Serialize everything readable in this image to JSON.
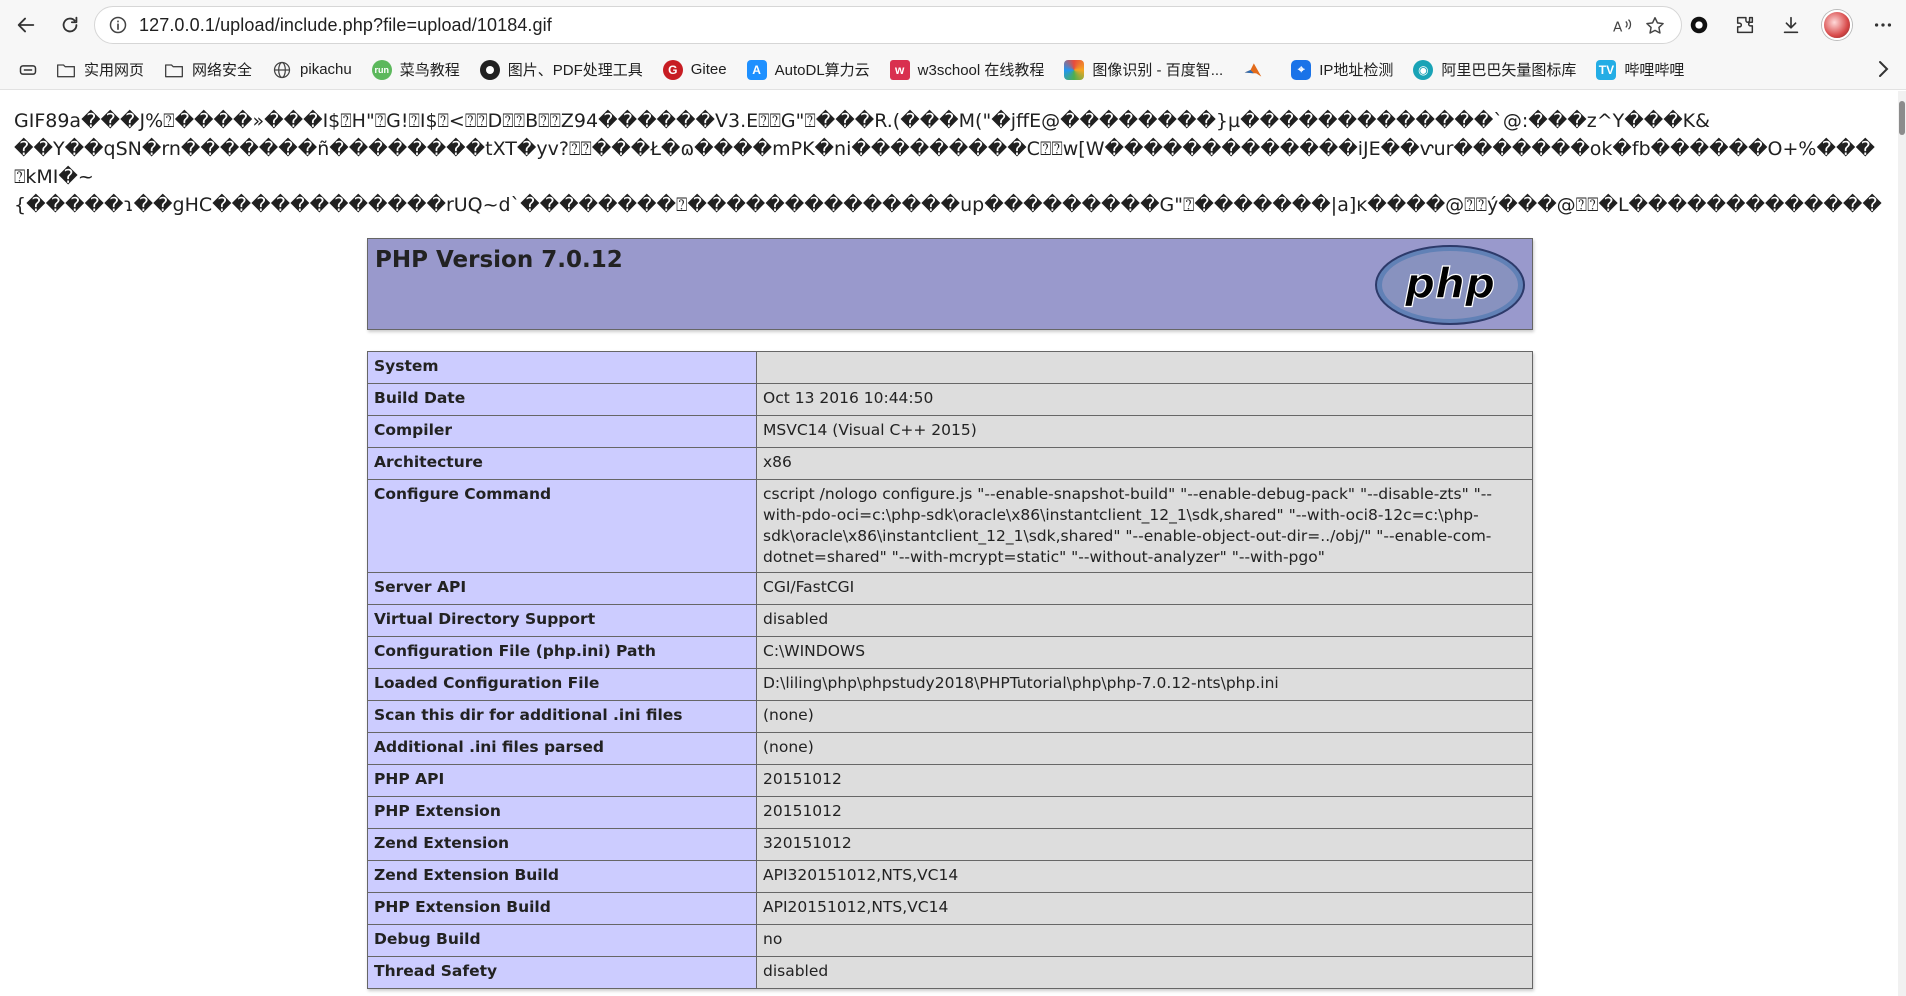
{
  "browser": {
    "url": "127.0.0.1/upload/include.php?file=upload/10184.gif",
    "bookmarks": [
      {
        "label": "实用网页",
        "icon": "folder-icon"
      },
      {
        "label": "网络安全",
        "icon": "folder-icon"
      },
      {
        "label": "pikachu",
        "icon": "globe-icon"
      },
      {
        "label": "菜鸟教程",
        "icon": "runoob-icon"
      },
      {
        "label": "图片、PDF处理工具",
        "icon": "tool-icon"
      },
      {
        "label": "Gitee",
        "icon": "gitee-icon"
      },
      {
        "label": "AutoDL算力云",
        "icon": "autodl-icon"
      },
      {
        "label": "w3school 在线教程",
        "icon": "w3school-icon"
      },
      {
        "label": "图像识别 - 百度智...",
        "icon": "baidu-ai-icon"
      },
      {
        "label": "",
        "icon": "matlab-icon"
      },
      {
        "label": "IP地址检测",
        "icon": "ip-icon"
      },
      {
        "label": "阿里巴巴矢量图标库",
        "icon": "iconfont-icon"
      },
      {
        "label": "哔哩哔哩",
        "icon": "bilibili-icon"
      }
    ]
  },
  "garbage_lines": [
    "GIF89a���J%⍰����»���I$⍰H\"⍰G!⍰I$⍰<⍰⍰D⍰⍰B⍰⍰Z94������V3.E⍰⍰G\"⍰���R.(���M(\"�jffE@��������}µ�������������`@:���z^Y���K&",
    "��Y��qSN�rn�������ñ��������tXT�yv?⍰⍰���Ł�ɷ����mPK�ni���������C⍰⍰w[W�������������iJE��ⱱur�������ok�fb������O+%���",
    "⍰kMI�~",
    "{�����ɿ��gHC������������rUQ~d`��������⍰��������������up���������G\"⍰�������|a]ĸ����@⍰⍰ý���@⍰⍰�L�������������"
  ],
  "phpinfo": {
    "title": "PHP Version 7.0.12",
    "rows": [
      {
        "key": "System",
        "value": ""
      },
      {
        "key": "Build Date",
        "value": "Oct 13 2016 10:44:50"
      },
      {
        "key": "Compiler",
        "value": "MSVC14 (Visual C++ 2015)"
      },
      {
        "key": "Architecture",
        "value": "x86"
      },
      {
        "key": "Configure Command",
        "value": "cscript /nologo configure.js \"--enable-snapshot-build\" \"--enable-debug-pack\" \"--disable-zts\" \"--with-pdo-oci=c:\\php-sdk\\oracle\\x86\\instantclient_12_1\\sdk,shared\" \"--with-oci8-12c=c:\\php-sdk\\oracle\\x86\\instantclient_12_1\\sdk,shared\" \"--enable-object-out-dir=../obj/\" \"--enable-com-dotnet=shared\" \"--with-mcrypt=static\" \"--without-analyzer\" \"--with-pgo\""
      },
      {
        "key": "Server API",
        "value": "CGI/FastCGI"
      },
      {
        "key": "Virtual Directory Support",
        "value": "disabled"
      },
      {
        "key": "Configuration File (php.ini) Path",
        "value": "C:\\WINDOWS"
      },
      {
        "key": "Loaded Configuration File",
        "value": "D:\\liling\\php\\phpstudy2018\\PHPTutorial\\php\\php-7.0.12-nts\\php.ini"
      },
      {
        "key": "Scan this dir for additional .ini files",
        "value": "(none)"
      },
      {
        "key": "Additional .ini files parsed",
        "value": "(none)"
      },
      {
        "key": "PHP API",
        "value": "20151012"
      },
      {
        "key": "PHP Extension",
        "value": "20151012"
      },
      {
        "key": "Zend Extension",
        "value": "320151012"
      },
      {
        "key": "Zend Extension Build",
        "value": "API320151012,NTS,VC14"
      },
      {
        "key": "PHP Extension Build",
        "value": "API20151012,NTS,VC14"
      },
      {
        "key": "Debug Build",
        "value": "no"
      },
      {
        "key": "Thread Safety",
        "value": "disabled"
      }
    ]
  }
}
